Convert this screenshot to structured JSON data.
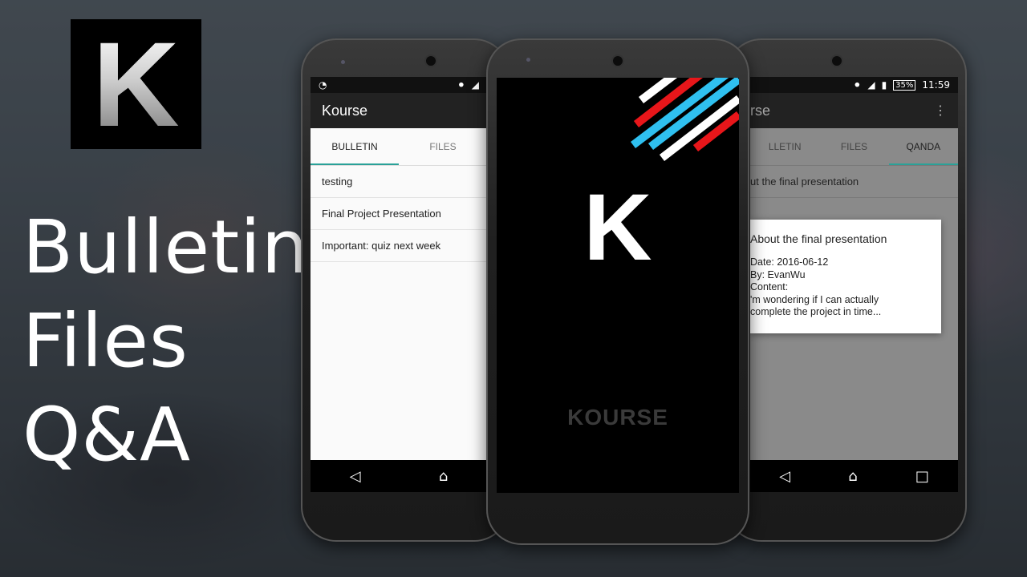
{
  "logo_letter": "K",
  "hero_lines": [
    "Bulletin",
    "Files",
    "Q&A"
  ],
  "left_phone": {
    "app_title": "Kourse",
    "tabs": [
      "BULLETIN",
      "FILES"
    ],
    "items": [
      "testing",
      "Final Project Presentation",
      "Important: quiz next week"
    ]
  },
  "center_phone": {
    "letter": "K",
    "brand": "KOURSE",
    "stripe_colors": [
      "#ffffff",
      "#e8161a",
      "#2fc0f0"
    ]
  },
  "right_phone": {
    "status": {
      "battery": "35%",
      "time": "11:59"
    },
    "app_title_partial": "rse",
    "tabs": [
      "LLETIN",
      "FILES",
      "QANDA"
    ],
    "list_item": "ut the final presentation",
    "dialog": {
      "title": "About the final presentation",
      "date": "Date: 2016-06-12",
      "by": "By: EvanWu",
      "content_label": "Content:",
      "content_line1": "'m wondering if I can actually",
      "content_line2": "complete the project in time..."
    }
  }
}
